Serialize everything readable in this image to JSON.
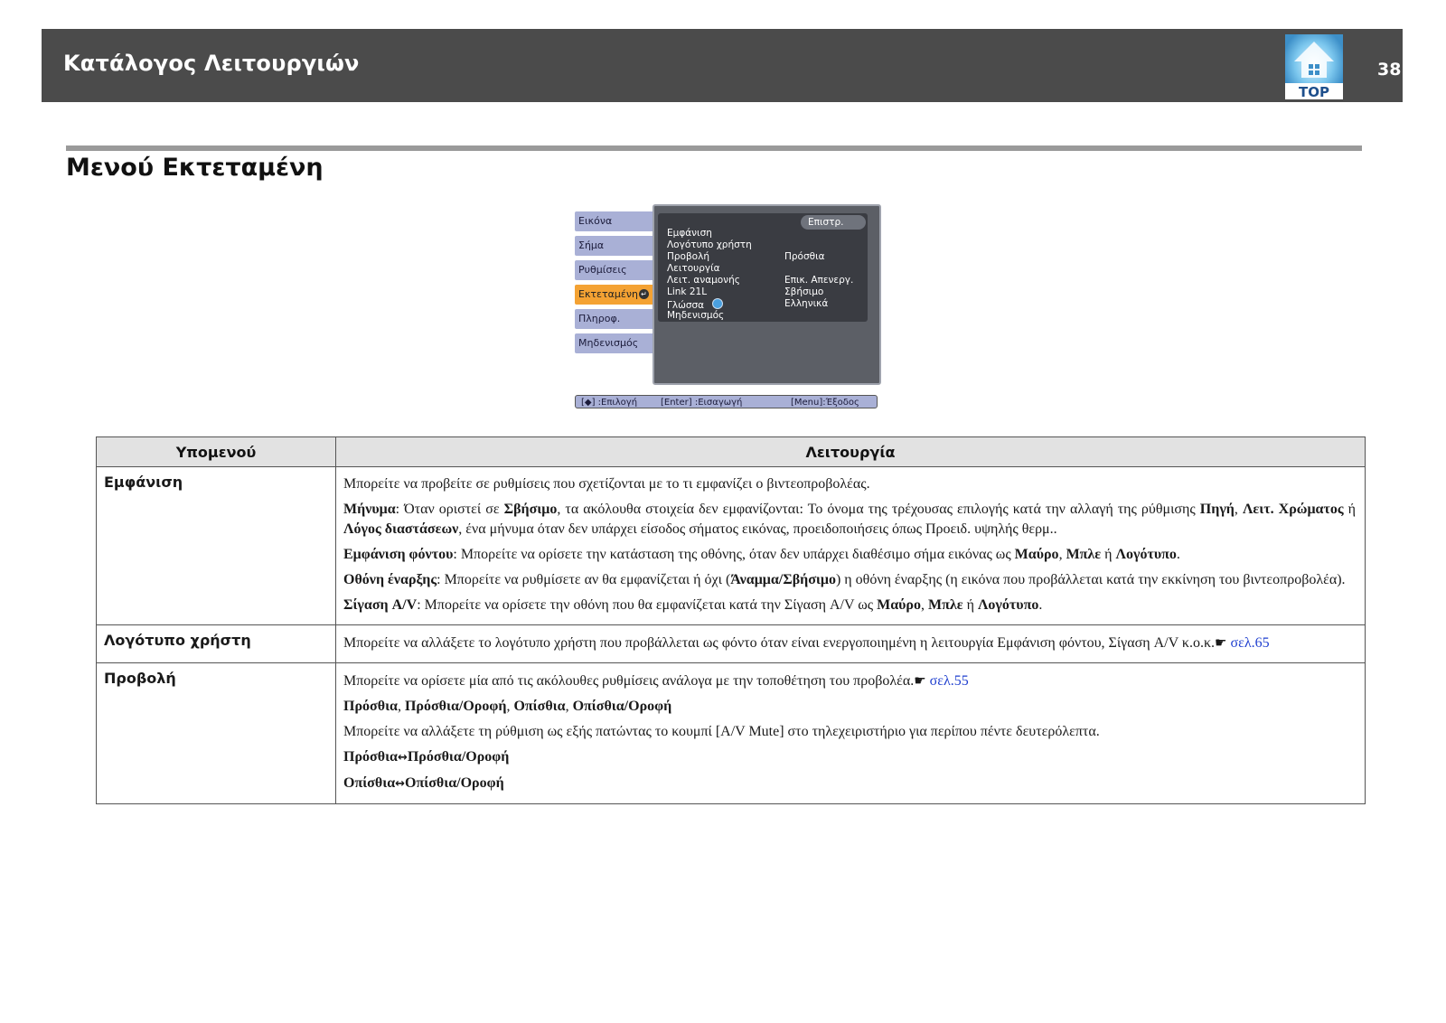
{
  "header": {
    "title": "Κατάλογος Λειτουργιών",
    "top_label": "TOP",
    "page_number": "38"
  },
  "section": {
    "title": "Μενού Εκτεταμένη"
  },
  "menu_screenshot": {
    "left_tabs": [
      "Εικόνα",
      "Σήμα",
      "Ρυθμίσεις",
      "Εκτεταμένη",
      "Πληροφ.",
      "Μηδενισμός"
    ],
    "active_tab": "Εκτεταμένη",
    "back_button": "Επιστρ.",
    "items": [
      {
        "label": "Εμφάνιση",
        "value": ""
      },
      {
        "label": "Λογότυπο χρήστη",
        "value": ""
      },
      {
        "label": "Προβολή",
        "value": "Πρόσθια"
      },
      {
        "label": "Λειτουργία",
        "value": ""
      },
      {
        "label": "Λειτ. αναμονής",
        "value": "Επικ. Απενεργ."
      },
      {
        "label": "Link 21L",
        "value": "Σβήσιμο"
      },
      {
        "label": "Γλώσσα",
        "value": "Ελληνικά"
      },
      {
        "label": "Μηδενισμός",
        "value": ""
      }
    ],
    "status": {
      "select": "[◆] :Επιλογή",
      "enter": "[Enter] :Εισαγωγή",
      "exit": "[Menu]:Έξοδος"
    }
  },
  "table": {
    "headers": [
      "Υπομενού",
      "Λειτουργία"
    ],
    "rows": {
      "emfanisi": {
        "name": "Εμφάνιση",
        "intro": "Μπορείτε να προβείτε σε ρυθμίσεις που σχετίζονται με το τι εμφανίζει ο βιντεοπροβολέας.",
        "p1": {
          "t1": "Μήνυμα",
          "t2": ": Όταν οριστεί σε ",
          "t3": "Σβήσιμο",
          "t4": ", τα ακόλουθα στοιχεία δεν εμφανίζονται: Το όνομα της τρέχουσας επιλογής κατά την αλλαγή της ρύθμισης ",
          "t5": "Πηγή",
          "t6": ", ",
          "t7": "Λειτ. Χρώματος",
          "t8": " ή ",
          "t9": "Λόγος διαστάσεων",
          "t10": ", ένα μήνυμα όταν δεν υπάρχει είσοδος σήματος εικόνας, προειδοποιήσεις όπως Προειδ. υψηλής θερμ.."
        },
        "p2": {
          "t1": "Εμφάνιση φόντου",
          "t2": ": Μπορείτε να ορίσετε την κατάσταση της οθόνης, όταν δεν υπάρχει διαθέσιμο σήμα εικόνας ως ",
          "t3": "Μαύρο",
          "t4": ", ",
          "t5": "Μπλε",
          "t6": " ή ",
          "t7": "Λογότυπο",
          "t8": "."
        },
        "p3": {
          "t1": "Οθόνη έναρξης",
          "t2": ": Μπορείτε να ρυθμίσετε αν θα εμφανίζεται ή όχι (",
          "t3": "Άναμμα",
          "t4": "/",
          "t5": "Σβήσιμο",
          "t6": ") η οθόνη έναρξης (η εικόνα που προβάλλεται κατά την εκκίνηση του βιντεοπροβολέα)."
        },
        "p4": {
          "t1": "Σίγαση A/V",
          "t2": ": Μπορείτε να ορίσετε την οθόνη που θα εμφανίζεται κατά την Σίγαση A/V ως ",
          "t3": "Μαύρο",
          "t4": ", ",
          "t5": "Μπλε",
          "t6": " ή ",
          "t7": "Λογότυπο",
          "t8": "."
        }
      },
      "logo": {
        "name": "Λογότυπο χρήστη",
        "text": "Μπορείτε να αλλάξετε το λογότυπο χρήστη που προβάλλεται ως φόντο όταν είναι ενεργοποιημένη η λειτουργία Εμφάνιση φόντου, Σίγαση A/V κ.ο.κ.",
        "link": "σελ.65"
      },
      "provoli": {
        "name": "Προβολή",
        "intro": "Μπορείτε να ορίσετε μία από τις ακόλουθες ρυθμίσεις ανάλογα με την τοποθέτηση του προβολέα.",
        "link": "σελ.55",
        "options": {
          "o1": "Πρόσθια",
          "o2": "Πρόσθια/Οροφή",
          "o3": "Οπίσθια",
          "o4": "Οπίσθια/Οροφή",
          "sep": ", "
        },
        "note": "Μπορείτε να αλλάξετε τη ρύθμιση ως εξής πατώντας το κουμπί [A/V Mute] στο τηλεχειριστήριο για περίπου πέντε δευτερόλεπτα.",
        "swap1": {
          "a": "Πρόσθια",
          "b": "Πρόσθια/Οροφή"
        },
        "swap2": {
          "a": "Οπίσθια",
          "b": "Οπίσθια/Οροφή"
        }
      }
    }
  },
  "icons": {
    "top": "home-top-icon",
    "pointer": "hand-pointer-icon",
    "swap": "double-arrow-icon",
    "globe": "globe-icon",
    "enter": "enter-icon"
  },
  "colors": {
    "header_bg": "#4b4b4b",
    "link": "#1f3fcf",
    "active_tab": "#f4a233",
    "tab": "#a9b0d6"
  }
}
